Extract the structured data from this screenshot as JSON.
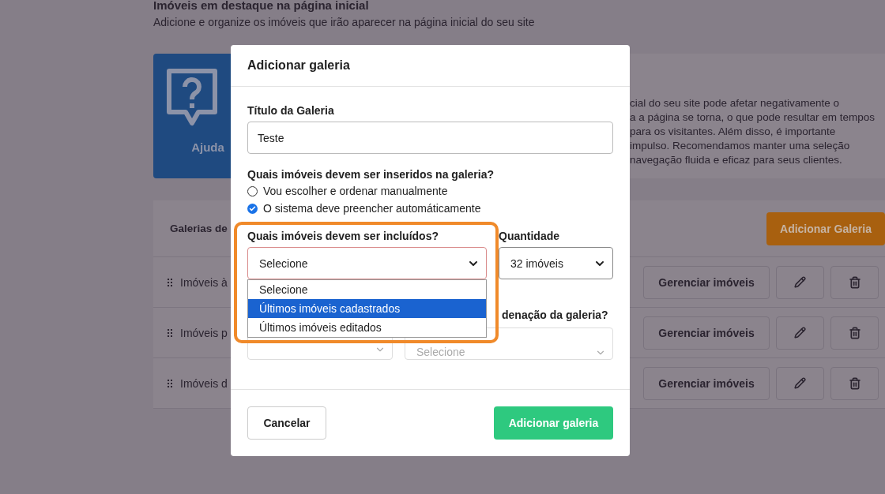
{
  "page": {
    "title": "Imóveis em destaque na página inicial",
    "subtitle": "Adicione e organize os imóveis que irão aparecer na página inicial do seu site"
  },
  "help": {
    "tile_label": "Ajuda",
    "text_lines": [
      "cial do seu site pode afetar negativamente o",
      "a a página se torna, o que pode resultar em tempos",
      "para os visitantes. Além disso, é importante",
      "impulso. Recomendamos manter uma seleção",
      "navegação fluida e eficaz para seus clientes."
    ]
  },
  "galleries": {
    "title": "Galerias de",
    "add_button": "Adicionar Galeria",
    "rows": [
      {
        "name": "Imóveis à",
        "manage_button": "Gerenciar imóveis"
      },
      {
        "name": "Imóveis p",
        "manage_button": "Gerenciar imóveis"
      },
      {
        "name": "Imóveis d",
        "manage_button": "Gerenciar imóveis"
      }
    ]
  },
  "modal": {
    "title": "Adicionar galeria",
    "title_label": "Título da Galeria",
    "title_value": "Teste",
    "mode_question": "Quais imóveis devem ser inseridos na galeria?",
    "mode_options": [
      {
        "label": "Vou escolher e ordenar manualmente",
        "selected": false
      },
      {
        "label": "O sistema deve preencher automáticamente",
        "selected": true
      }
    ],
    "include_label": "Quais imóveis devem ser incluídos?",
    "include_value": "Selecione",
    "include_error": true,
    "include_options": [
      {
        "label": "Selecione",
        "selected": false
      },
      {
        "label": "Últimos imóveis cadastrados",
        "selected": true
      },
      {
        "label": "Últimos imóveis editados",
        "selected": false
      }
    ],
    "quantity_label": "Quantidade",
    "quantity_value": "32 imóveis",
    "order_label": "denação da galeria?",
    "order_placeholder": "Selecione",
    "cancel_button": "Cancelar",
    "submit_button": "Adicionar galeria"
  }
}
